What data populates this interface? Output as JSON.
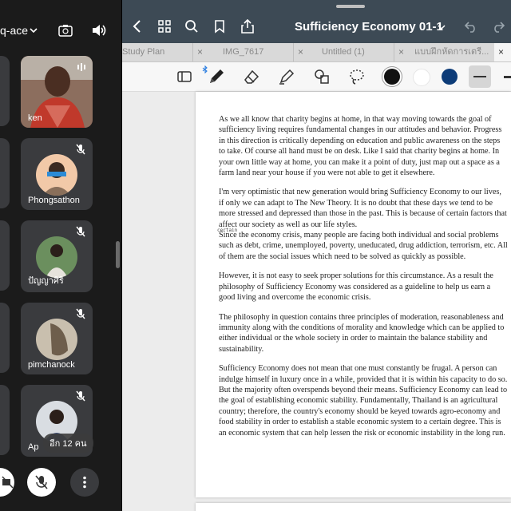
{
  "meet": {
    "code": "q-ace",
    "participants": [
      {
        "name": "ken"
      },
      {
        "name": "Phongsathon"
      },
      {
        "name": "ปัญญาศิริ"
      },
      {
        "name": "pimchanock"
      },
      {
        "name": "Ap"
      }
    ],
    "more_label": "อีก 12 คน"
  },
  "app": {
    "title": "Sufficiency Economy 01-1",
    "tabs": [
      {
        "label": "Study Plan"
      },
      {
        "label": "IMG_7617"
      },
      {
        "label": "Untitled (1)"
      },
      {
        "label": "แบบฝึกหัดการเตรี..."
      }
    ],
    "tab_close": "×",
    "colors": {
      "navbar": "#3d4a55",
      "swatch_black": "#111111",
      "swatch_white": "#ffffff",
      "swatch_navy": "#0d3c78",
      "swatch_gray": "#d0d0d0"
    }
  },
  "document": {
    "handwritten_note": "certain",
    "paragraphs": [
      "As we all know that charity begins at home, in that way moving towards the goal of sufficiency living requires fundamental changes in our attitudes and behavior. Progress in this direction is critically depending on education and public awareness on the steps to take. Of course all hand must be on desk. Like I said that charity begins at home. In your own little way at home, you can make it a point of duty, just map out a space as a farm land near your house if you were not able to get it elsewhere.",
      "I'm very optimistic that new generation would bring Sufficiency Economy to our lives, if only we can adapt to The New Theory. It is no doubt that these days we tend to be more stressed and depressed than those in the past. This is because of certain factors that affect our society as well as our life styles.",
      "Since the economy crisis, many people are facing both individual and social problems such as debt, crime, unemployed, poverty, uneducated, drug addiction, terrorism, etc. All of them are the social issues which need to be solved as quickly as possible.",
      "However, it is not easy to seek proper solutions for this circumstance. As a result the philosophy of Sufficiency Economy was considered as a guideline to help us earn a good living and overcome the economic crisis.",
      "The philosophy in question contains three principles of moderation, reasonableness and immunity along with the conditions of morality and knowledge which can be applied to either individual or the whole society in order to maintain the balance stability and sustainability.",
      "Sufficiency Economy does not mean that one must constantly be frugal. A person can indulge himself in luxury once in a while, provided that it is within his capacity to do so. But the majority often overspends beyond their means. Sufficiency Economy can lead to the goal of establishing economic stability. Fundamentally, Thailand is an agricultural country; therefore, the country's economy should be keyed towards agro-economy and food stability in order to establish a stable economic system to a certain degree. This is an economic system that can help lessen the risk or economic instability in the long run."
    ]
  }
}
